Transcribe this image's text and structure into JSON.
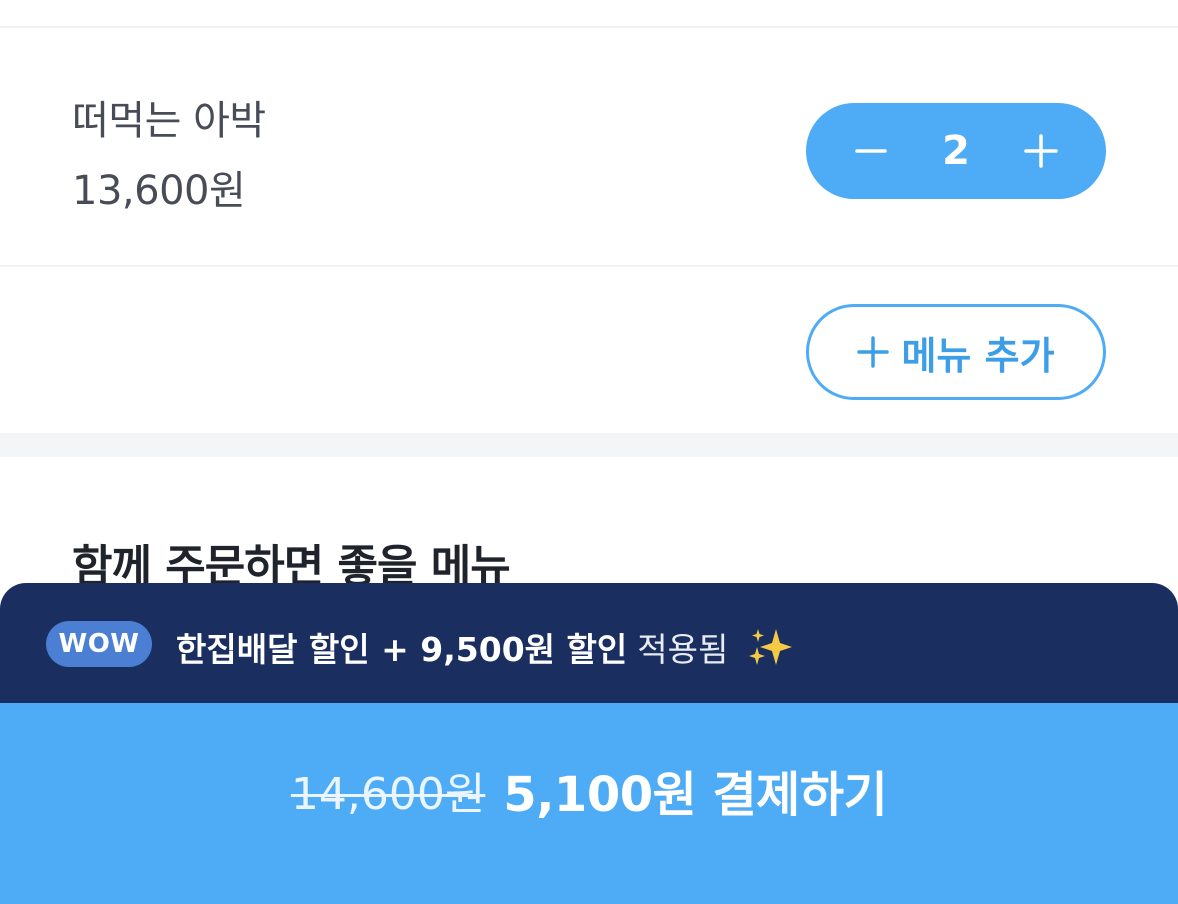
{
  "cart_item": {
    "name": "떠먹는 아박",
    "price": "13,600원",
    "quantity": "2"
  },
  "add_menu": {
    "label": "메뉴 추가"
  },
  "recommendations": {
    "title": "함께 주문하면 좋을 메뉴"
  },
  "wow_banner": {
    "badge": "WOW",
    "discount_text": "한집배달 할인 + 9,500원 할인",
    "applied_text": "적용됨"
  },
  "checkout": {
    "original_price": "14,600원",
    "pay_label": "5,100원 결제하기"
  },
  "colors": {
    "primary": "#4eabf6",
    "wow_bar": "#1a2f60",
    "wow_badge": "#4a7fd4"
  },
  "icons": {
    "decrement": "minus-icon",
    "increment": "plus-icon",
    "add": "plus-icon",
    "sparkle": "sparkles-icon"
  }
}
